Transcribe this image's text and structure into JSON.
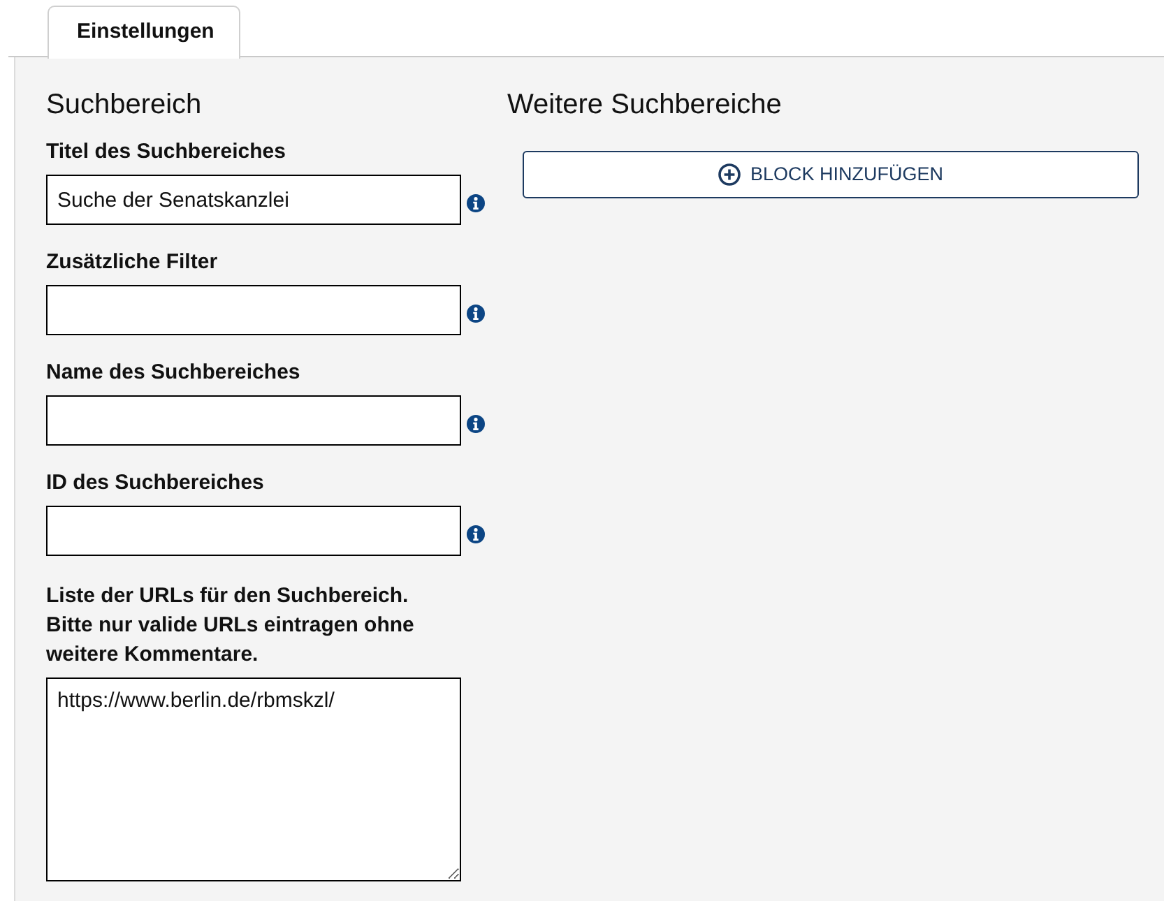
{
  "tabs": [
    {
      "label": "Einstellungen",
      "selected": true
    }
  ],
  "search_area": {
    "heading": "Suchbereich",
    "fields": [
      {
        "kind": "input",
        "label": "Titel des Suchbereiches",
        "value": "Suche der Senatskanzlei"
      },
      {
        "kind": "input",
        "label": "Zusätzliche Filter"
      },
      {
        "kind": "input",
        "label": "Name des Suchbereiches"
      },
      {
        "kind": "input",
        "label": "ID des Suchbereiches"
      },
      {
        "kind": "textarea",
        "label": "Liste der URLs für den Suchbereich. Bitte nur valide URLs eintragen ohne weitere Kommentare.",
        "value": "https://www.berlin.de/rbmskzl/"
      }
    ]
  },
  "more_search_areas": {
    "heading": "Weitere Suchbereiche",
    "add_button": {
      "label": "BLOCK HINZUFÜGEN"
    }
  }
}
